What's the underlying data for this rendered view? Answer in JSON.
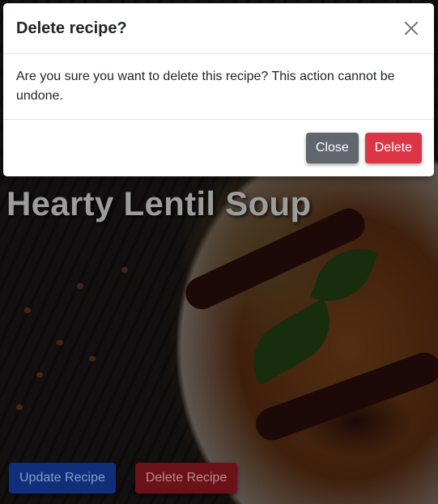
{
  "page": {
    "recipe_title": "Hearty Lentil Soup",
    "update_button": "Update Recipe",
    "delete_button": "Delete Recipe"
  },
  "modal": {
    "title": "Delete recipe?",
    "close_icon": "close-icon",
    "message": "Are you sure you want to delete this recipe? This action cannot be undone.",
    "close_label": "Close",
    "delete_label": "Delete"
  },
  "colors": {
    "danger": "#dc3545",
    "secondary": "#5f666c",
    "primary_dimmed": "#0f2f7a",
    "danger_dimmed": "#6b1219",
    "backdrop": "rgba(0,0,0,0.5)"
  }
}
